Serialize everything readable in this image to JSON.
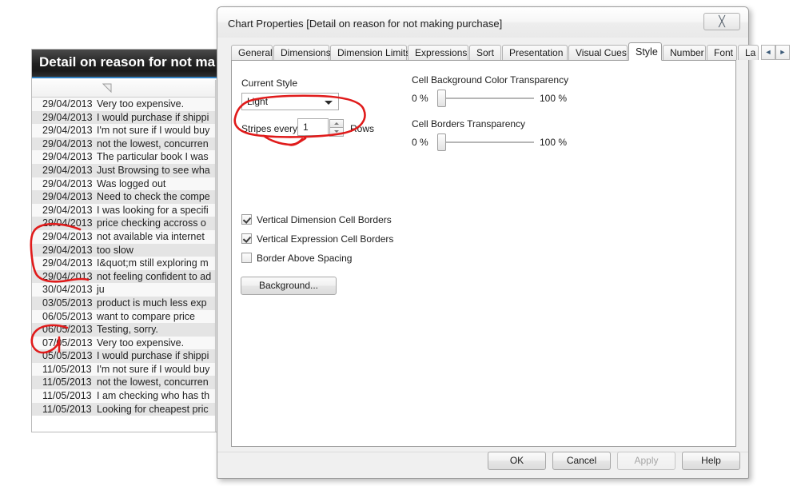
{
  "background_chart": {
    "caption": "Detail on reason for not ma",
    "caption_full": "Detail on reason for not making purchase",
    "sort_icon": "sort-descending-icon",
    "rows": [
      {
        "date": "29/04/2013",
        "text": "Very too expensive."
      },
      {
        "date": "29/04/2013",
        "text": "I would purchase if shippi"
      },
      {
        "date": "29/04/2013",
        "text": "I'm not sure if I would buy"
      },
      {
        "date": "29/04/2013",
        "text": "not the lowest, concurren"
      },
      {
        "date": "29/04/2013",
        "text": "The particular book I was"
      },
      {
        "date": "29/04/2013",
        "text": "Just Browsing to see wha"
      },
      {
        "date": "29/04/2013",
        "text": "Was logged out"
      },
      {
        "date": "29/04/2013",
        "text": "Need to check the compe"
      },
      {
        "date": "29/04/2013",
        "text": "I was looking for a specifi"
      },
      {
        "date": "29/04/2013",
        "text": "price checking accross o"
      },
      {
        "date": "29/04/2013",
        "text": "not available via internet"
      },
      {
        "date": "29/04/2013",
        "text": "too slow"
      },
      {
        "date": "29/04/2013",
        "text": "I&quot;m still exploring m"
      },
      {
        "date": "29/04/2013",
        "text": "not feeling confident to ad"
      },
      {
        "date": "30/04/2013",
        "text": "ju"
      },
      {
        "date": "03/05/2013",
        "text": "product is much less exp"
      },
      {
        "date": "06/05/2013",
        "text": "want to compare price"
      },
      {
        "date": "06/05/2013",
        "text": "Testing, sorry."
      },
      {
        "date": "07/05/2013",
        "text": "Very too expensive."
      },
      {
        "date": "05/05/2013",
        "text": "I would purchase if shippi"
      },
      {
        "date": "11/05/2013",
        "text": "I'm not sure if I would buy"
      },
      {
        "date": "11/05/2013",
        "text": "not the lowest, concurren"
      },
      {
        "date": "11/05/2013",
        "text": "I am checking who has th"
      },
      {
        "date": "11/05/2013",
        "text": "Looking for cheapest pric"
      }
    ]
  },
  "dialog": {
    "title": "Chart Properties [Detail on reason for not making purchase]",
    "close_icon": "close-icon",
    "tabs": [
      {
        "label": "General",
        "active": false
      },
      {
        "label": "Dimensions",
        "active": false
      },
      {
        "label": "Dimension Limits",
        "active": false
      },
      {
        "label": "Expressions",
        "active": false
      },
      {
        "label": "Sort",
        "active": false
      },
      {
        "label": "Presentation",
        "active": false
      },
      {
        "label": "Visual Cues",
        "active": false
      },
      {
        "label": "Style",
        "active": true
      },
      {
        "label": "Number",
        "active": false
      },
      {
        "label": "Font",
        "active": false
      },
      {
        "label": "La",
        "active": false
      }
    ],
    "tab_scroll_left": "◄",
    "tab_scroll_right": "►",
    "style_tab": {
      "current_style_label": "Current Style",
      "current_style_value": "Light",
      "current_style_options": [
        "Light"
      ],
      "stripes_label": "Stripes every",
      "stripes_value": "1",
      "rows_label": "Rows",
      "cell_bg_transparency_label": "Cell Background Color Transparency",
      "cell_bg_min": "0 %",
      "cell_bg_max": "100 %",
      "cell_borders_transparency_label": "Cell Borders Transparency",
      "cell_borders_min": "0 %",
      "cell_borders_max": "100 %",
      "checkboxes": [
        {
          "label": "Vertical Dimension Cell Borders",
          "checked": true
        },
        {
          "label": "Vertical Expression Cell Borders",
          "checked": true
        },
        {
          "label": "Border Above Spacing",
          "checked": false
        }
      ],
      "background_button": "Background..."
    },
    "footer": {
      "ok": "OK",
      "cancel": "Cancel",
      "apply": "Apply",
      "apply_disabled": true,
      "help": "Help"
    }
  },
  "annotations": {
    "color": "#e01b1b",
    "marks": [
      {
        "name": "ellipse-around-stripes-every",
        "shape": "ellipse-with-pointer"
      },
      {
        "name": "bracket-rows-april-29",
        "shape": "open-bracket"
      },
      {
        "name": "bracket-rows-may-06",
        "shape": "open-bracket"
      }
    ]
  }
}
